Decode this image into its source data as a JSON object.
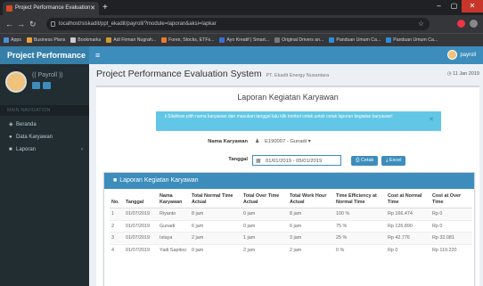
{
  "browser": {
    "tab_title": "Project Performance Evaluation",
    "url": "localhost/siskadit/ppt_ekadit/payroll/?module=laporan&aksi=lapkar",
    "bookmarks": [
      "Apps",
      "Business Plans",
      "Bookmarks",
      "Adi Firman Nugrah...",
      "Forex, Stocks, ETFs...",
      "Ayo Kreatif | Smart...",
      "Original Drivers an...",
      "Panduan Umum Ca...",
      "Panduan Umum Ca..."
    ]
  },
  "app": {
    "brand": "Project Performance",
    "user": "payroll",
    "sidebar": {
      "user_name": "(( Payroll ))",
      "nav_header": "MAIN NAVIGATION",
      "items": [
        {
          "label": "Beranda",
          "icon": "dashboard-icon"
        },
        {
          "label": "Data Karyawan",
          "icon": "user-icon"
        },
        {
          "label": "Laporan",
          "icon": "file-icon"
        }
      ]
    }
  },
  "page": {
    "title": "Project Performance Evaluation System",
    "subtitle": "PT. Ekadit Energy Nusantara",
    "date": "11 Jan 2019",
    "report_title": "Laporan Kegiatan Karyawan",
    "alert": "Silahkan pilih nama karyawan dan masukan tanggal lalu klik tombol cetak untuk cetak laporan kegiatan karyawan!",
    "form": {
      "employee_label": "Nama Karyawan",
      "employee_value": "E190007 - Gunadi",
      "date_label": "Tanggal",
      "date_value": "01/01/2019 - 05/01/2019",
      "print_btn": "Cetak",
      "excel_btn": "Excel"
    },
    "table": {
      "title": "Laporan Kegiatan Karyawan",
      "headers": [
        "No.",
        "Tanggal",
        "Nama Karyawan",
        "Total Normal Time Actual",
        "Total Over Time Actual",
        "Total Work Hour Actual",
        "Time Efficiency at Normal Time",
        "Cost at Normal Time",
        "Cost at Over Time"
      ],
      "rows": [
        [
          "1",
          "01/07/2019",
          "Riyanto",
          "8 jam",
          "0 jam",
          "8 jam",
          "100 %",
          "Rp 166.474",
          "Rp 0"
        ],
        [
          "2",
          "01/07/2019",
          "Gunadi",
          "6 jam",
          "0 jam",
          "6 jam",
          "75 %",
          "Rp 126.890",
          "Rp 0"
        ],
        [
          "3",
          "01/07/2019",
          "Istaya",
          "2 jam",
          "1 jam",
          "3 jam",
          "25 %",
          "Rp 42.776",
          "Rp 32.081"
        ],
        [
          "4",
          "01/07/2019",
          "Yadi Sapitoo",
          "0 jam",
          "2 jam",
          "2 jam",
          "0 %",
          "Rp 0",
          "Rp 119.220"
        ]
      ]
    }
  },
  "colors": {
    "primary": "#3c8dbc",
    "sidebar": "#222d32",
    "alert": "#62c7e6"
  }
}
